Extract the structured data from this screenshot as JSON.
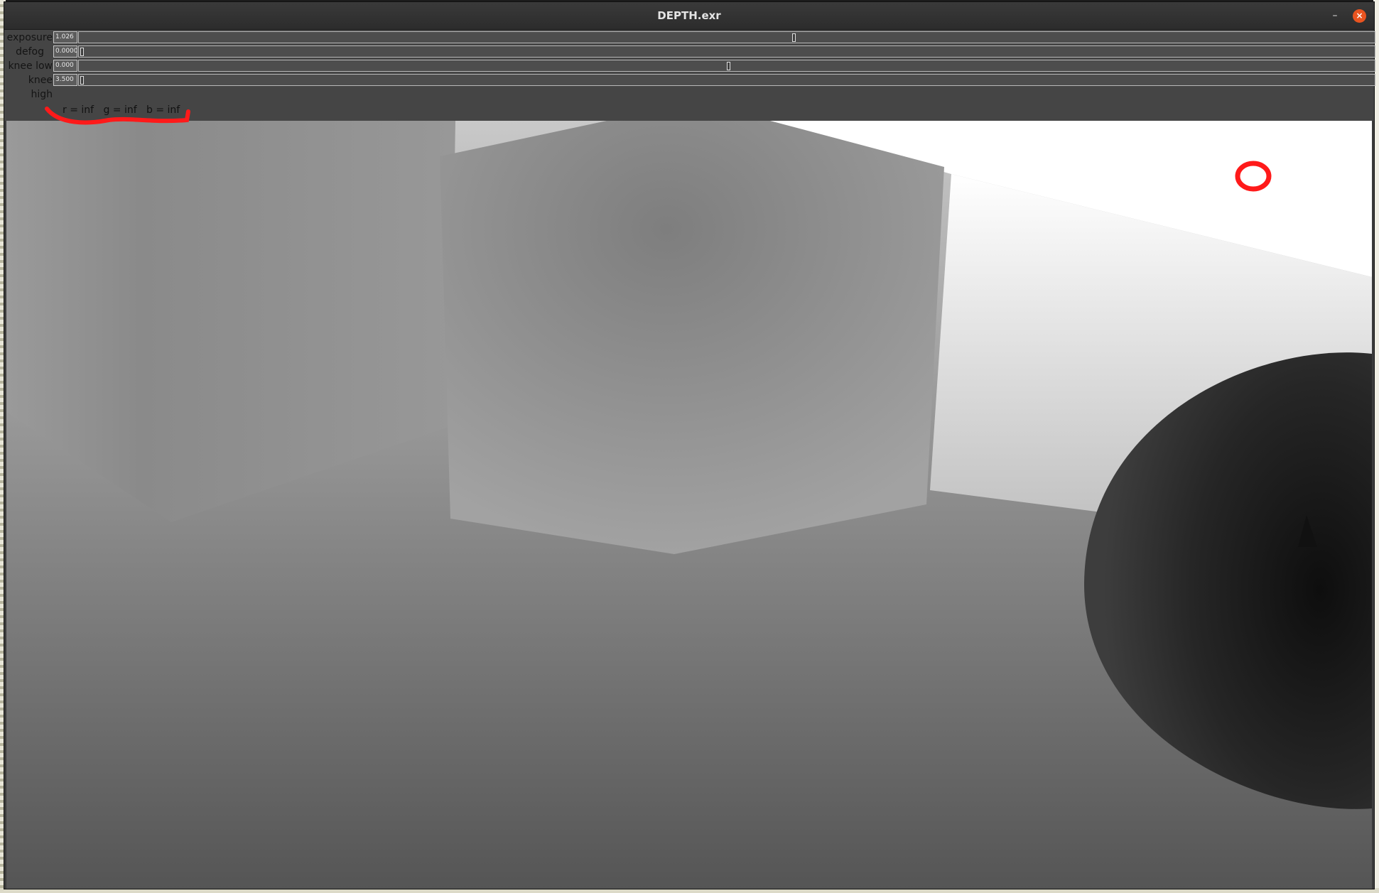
{
  "window": {
    "title": "DEPTH.exr",
    "minimize_label": "–",
    "close_label": "×"
  },
  "controls": [
    {
      "label": "exposure",
      "value": "1.026",
      "position": 0.5517
    },
    {
      "label": "defog",
      "value": "0.0000",
      "position": 0.0
    },
    {
      "label": "knee low",
      "value": "0.000",
      "position": 0.5013
    },
    {
      "label": "knee high",
      "value": "3.500",
      "position": 0.0
    }
  ],
  "pixel_readout": {
    "r": "r = inf",
    "g": "g = inf",
    "b": "b = inf"
  },
  "annotation_color": "#ff1a1a",
  "icons": {
    "minimize": "minimize-icon",
    "close": "close-icon"
  }
}
